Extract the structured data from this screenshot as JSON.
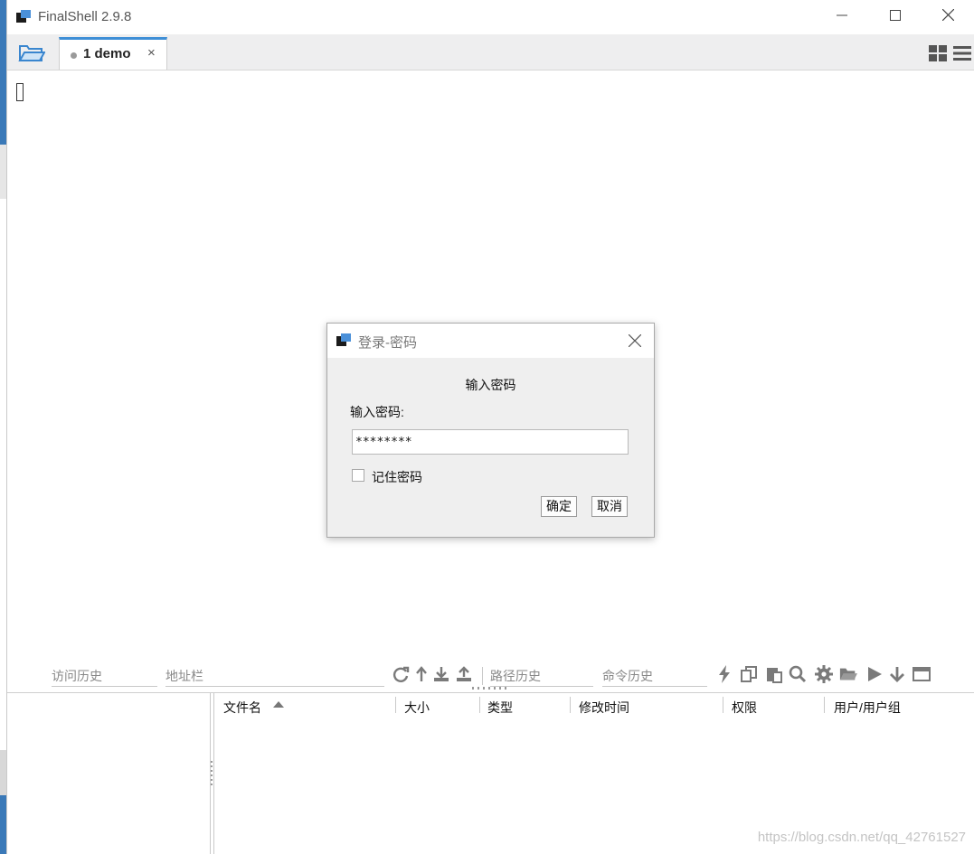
{
  "window": {
    "title": "FinalShell 2.9.8"
  },
  "tabs": [
    {
      "label": "1 demo",
      "close": "×"
    }
  ],
  "dialog": {
    "title": "登录-密码",
    "heading": "输入密码",
    "label": "输入密码:",
    "password_value": "********",
    "remember_label": "记住密码",
    "ok_label": "确定",
    "cancel_label": "取消"
  },
  "toolbar": {
    "history_placeholder": "访问历史",
    "address_placeholder": "地址栏",
    "path_history_placeholder": "路径历史",
    "command_history_placeholder": "命令历史"
  },
  "file_table": {
    "columns": [
      "文件名",
      "大小",
      "类型",
      "修改时间",
      "权限",
      "用户/用户组"
    ]
  },
  "watermark": "https://blog.csdn.net/qq_42761527",
  "colors": {
    "accent": "#3f8fd6",
    "icon": "#7a7a7a"
  }
}
